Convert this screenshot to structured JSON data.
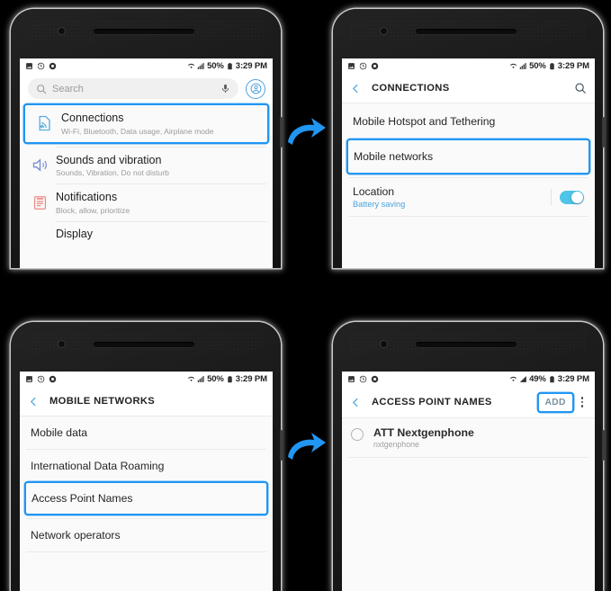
{
  "meta": {
    "accent": "#2196F3",
    "link": "#4aa3dd",
    "toggle_on": "#4FC3E8"
  },
  "panels": [
    {
      "id": "settings-home",
      "status": {
        "battery": "50%",
        "time": "3:29 PM",
        "icons": [
          "image-icon",
          "history-icon",
          "gear-icon",
          "wifi-icon",
          "signal-icon",
          "battery-icon"
        ]
      },
      "search": {
        "placeholder": "Search",
        "mic_icon": "microphone-icon",
        "avatar_icon": "account-icon"
      },
      "items": [
        {
          "title": "Connections",
          "subtitle": "Wi-Fi, Bluetooth, Data usage, Airplane mode",
          "icon": "connections-icon",
          "highlighted": true
        },
        {
          "title": "Sounds and vibration",
          "subtitle": "Sounds, Vibration, Do not disturb",
          "icon": "sound-icon",
          "highlighted": false
        },
        {
          "title": "Notifications",
          "subtitle": "Block, allow, prioritize",
          "icon": "notifications-icon",
          "highlighted": false
        },
        {
          "title": "Display",
          "subtitle": "",
          "icon": "display-icon",
          "highlighted": false
        }
      ]
    },
    {
      "id": "connections",
      "status": {
        "battery": "50%",
        "time": "3:29 PM"
      },
      "appbar": {
        "title": "CONNECTIONS",
        "back_icon": "back-chevron-icon",
        "search_icon": "search-icon"
      },
      "rows": [
        {
          "title": "Mobile Hotspot and Tethering",
          "highlighted": false
        },
        {
          "title": "Mobile networks",
          "highlighted": true
        },
        {
          "title": "Location",
          "subtitle": "Battery saving",
          "toggle": "on",
          "highlighted": false
        }
      ]
    },
    {
      "id": "mobile-networks",
      "status": {
        "battery": "50%",
        "time": "3:29 PM"
      },
      "appbar": {
        "title": "MOBILE NETWORKS",
        "back_icon": "back-chevron-icon"
      },
      "rows": [
        {
          "title": "Mobile data",
          "highlighted": false
        },
        {
          "title": "International Data Roaming",
          "highlighted": false
        },
        {
          "title": "Access Point Names",
          "highlighted": true
        },
        {
          "title": "Network operators",
          "highlighted": false
        }
      ]
    },
    {
      "id": "access-point-names",
      "status": {
        "battery": "49%",
        "time": "3:29 PM"
      },
      "appbar": {
        "title": "ACCESS POINT NAMES",
        "back_icon": "back-chevron-icon",
        "add_label": "ADD",
        "add_highlighted": true,
        "overflow_icon": "kebab-menu-icon"
      },
      "apns": [
        {
          "name": "ATT Nextgenphone",
          "apn": "nxtgenphone",
          "selected": false
        }
      ]
    }
  ],
  "arrows": [
    {
      "name": "flow-arrow-1",
      "direction": "up-right"
    },
    {
      "name": "flow-arrow-2",
      "direction": "up-right"
    }
  ]
}
